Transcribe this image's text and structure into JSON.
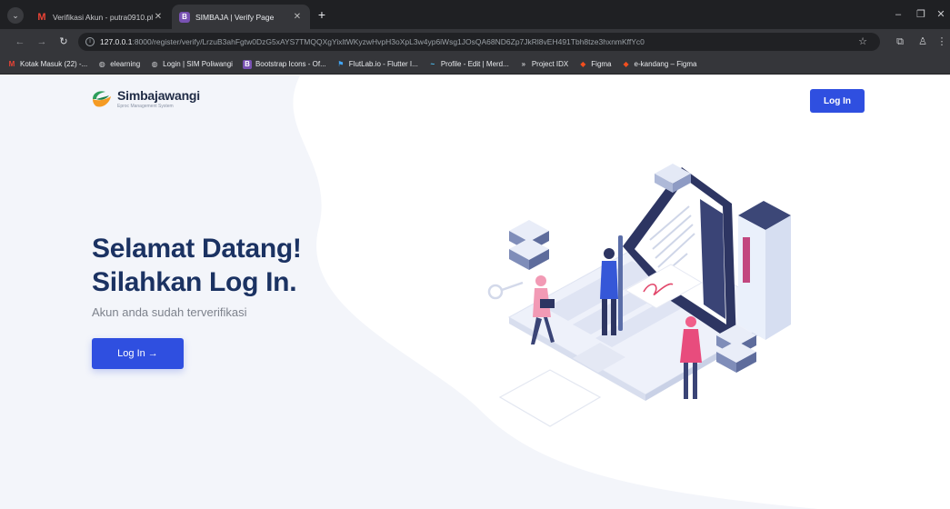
{
  "browser": {
    "tabs": [
      {
        "title": "Verifikasi Akun - putra0910.ph...",
        "icon": "gmail-icon",
        "active": false
      },
      {
        "title": "SIMBAJA | Verify Page",
        "icon": "bootstrap-icon",
        "active": true
      }
    ],
    "url_host": "127.0.0.1",
    "url_path": ":8000/register/verify/LrzuB3ahFgtw0DzG5xAYS7TMQQXgYixltWKyzwHvpH3oXpL3w4yp6iWsg1JOsQA68ND6Zp7JkRl8vEH491Tbh8tze3hxnmKffYc0",
    "bookmarks": [
      {
        "label": "Kotak Masuk (22) -...",
        "icon": "gmail-icon"
      },
      {
        "label": "elearning",
        "icon": "globe-icon"
      },
      {
        "label": "Login | SIM Poliwangi",
        "icon": "globe-icon"
      },
      {
        "label": "Bootstrap Icons - Of...",
        "icon": "bootstrap-icon"
      },
      {
        "label": "FlutLab.io - Flutter I...",
        "icon": "flutter-icon"
      },
      {
        "label": "Profile - Edit | Merd...",
        "icon": "merdeka-icon"
      },
      {
        "label": "Project IDX",
        "icon": "idx-icon"
      },
      {
        "label": "Figma",
        "icon": "figma-icon"
      },
      {
        "label": "e-kandang – Figma",
        "icon": "figma-icon"
      }
    ]
  },
  "header": {
    "logo_name": "Simbajawangi",
    "logo_tagline": "Eproc Management System",
    "login_label": "Log In"
  },
  "hero": {
    "line1": "Selamat Datang!",
    "line2": "Silahkan Log In.",
    "subtitle": "Akun anda sudah terverifikasi",
    "cta_label": "Log In →"
  },
  "colors": {
    "primary": "#2f4fe0",
    "heading": "#1b3262",
    "background_tint": "#eef1f8"
  }
}
